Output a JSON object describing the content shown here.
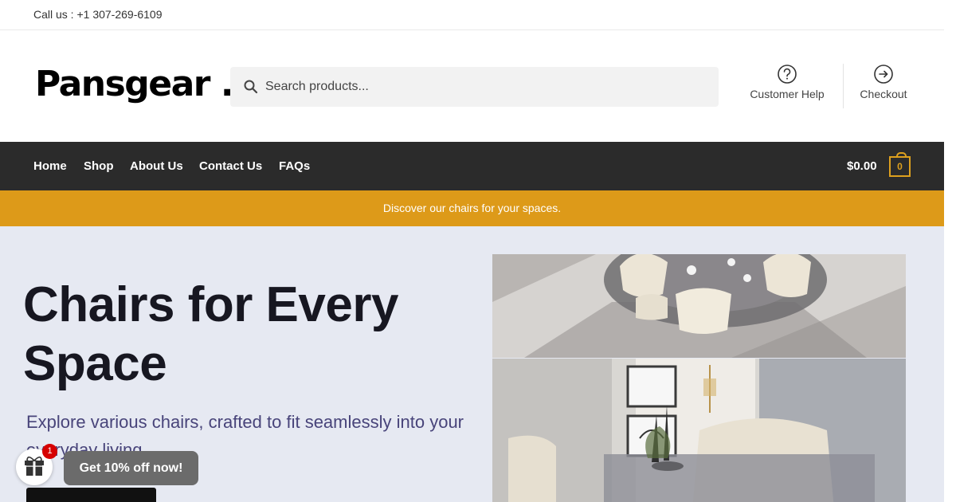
{
  "topbar": {
    "call_text": "Call us : +1 307-269-6109"
  },
  "header": {
    "logo_text": "Pansgear .",
    "search": {
      "placeholder": "Search products...",
      "value": ""
    },
    "links": {
      "help_label": "Customer Help",
      "checkout_label": "Checkout"
    }
  },
  "nav": {
    "items": [
      {
        "label": "Home"
      },
      {
        "label": "Shop"
      },
      {
        "label": "About Us"
      },
      {
        "label": "Contact Us"
      },
      {
        "label": "FAQs"
      }
    ],
    "cart_total": "$0.00",
    "cart_count": "0"
  },
  "promo": {
    "text": "Discover our chairs for your spaces."
  },
  "hero": {
    "title": "Chairs for Every Space",
    "subtitle": "Explore various chairs, crafted to fit seamlessly into your everyday living."
  },
  "popup": {
    "badge_count": "1",
    "label": "Get 10% off now!"
  },
  "colors": {
    "accent": "#dd9a19",
    "nav_bg": "#2b2b2b",
    "hero_bg": "#e6e9f2"
  },
  "icons": [
    "search-icon",
    "question-circle-icon",
    "arrow-circle-icon",
    "cart-icon",
    "gift-icon"
  ]
}
